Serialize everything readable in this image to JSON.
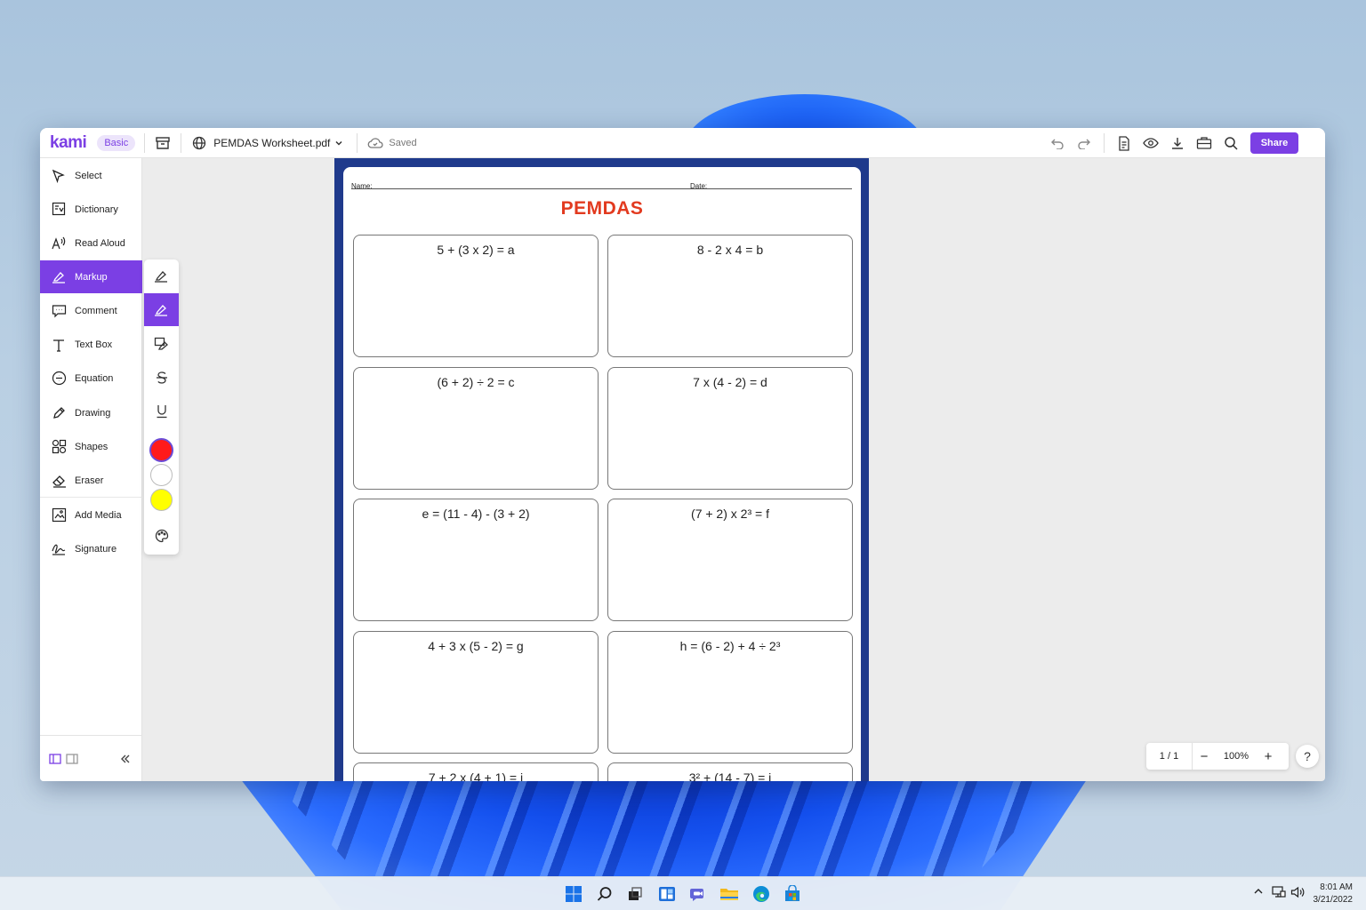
{
  "app": {
    "logo": "kami",
    "plan": "Basic",
    "file_name": "PEMDAS Worksheet.pdf",
    "save_status": "Saved",
    "share_label": "Share"
  },
  "sidebar": {
    "items": [
      {
        "label": "Select",
        "icon": "cursor-icon"
      },
      {
        "label": "Dictionary",
        "icon": "dictionary-icon"
      },
      {
        "label": "Read Aloud",
        "icon": "read-aloud-icon"
      },
      {
        "label": "Markup",
        "icon": "markup-icon",
        "active": true
      },
      {
        "label": "Comment",
        "icon": "comment-icon"
      },
      {
        "label": "Text Box",
        "icon": "text-box-icon"
      },
      {
        "label": "Equation",
        "icon": "equation-icon"
      },
      {
        "label": "Drawing",
        "icon": "pen-icon"
      },
      {
        "label": "Shapes",
        "icon": "shapes-icon"
      },
      {
        "label": "Eraser",
        "icon": "eraser-icon"
      },
      {
        "label": "Add Media",
        "icon": "add-media-icon"
      },
      {
        "label": "Signature",
        "icon": "signature-icon"
      }
    ]
  },
  "markup_flyout": {
    "tools": [
      "highlighter-icon",
      "highlighter-active-icon",
      "area-highlight-icon",
      "strikethrough-icon",
      "underline-icon"
    ],
    "colors": [
      "#ff1a1a",
      "#ffffff",
      "#ffff00"
    ],
    "selected_color": "#ff1a1a"
  },
  "document": {
    "name_label": "Name:",
    "date_label": "Date:",
    "title": "PEMDAS",
    "problems": [
      "5 + (3 x 2) = a",
      "8 - 2 x 4 = b",
      "(6 + 2) ÷ 2 = c",
      "7 x (4 - 2) = d",
      "e = (11 - 4) - (3 + 2)",
      "(7 + 2) x 2³ = f",
      "4 + 3 x (5 - 2) = g",
      "h = (6 - 2) + 4 ÷ 2³",
      "7 + 2 x (4 + 1) = i",
      "3² + (14 - 7) = j"
    ]
  },
  "page_controls": {
    "page": "1 / 1",
    "zoom": "100%",
    "minus": "−",
    "plus": "+",
    "help": "?"
  },
  "taskbar": {
    "time": "8:01 AM",
    "date": "3/21/2022"
  },
  "colors": {
    "accent": "#7b3fe4",
    "title_red": "#e23a1f",
    "doc_border": "#1f3a8c"
  }
}
